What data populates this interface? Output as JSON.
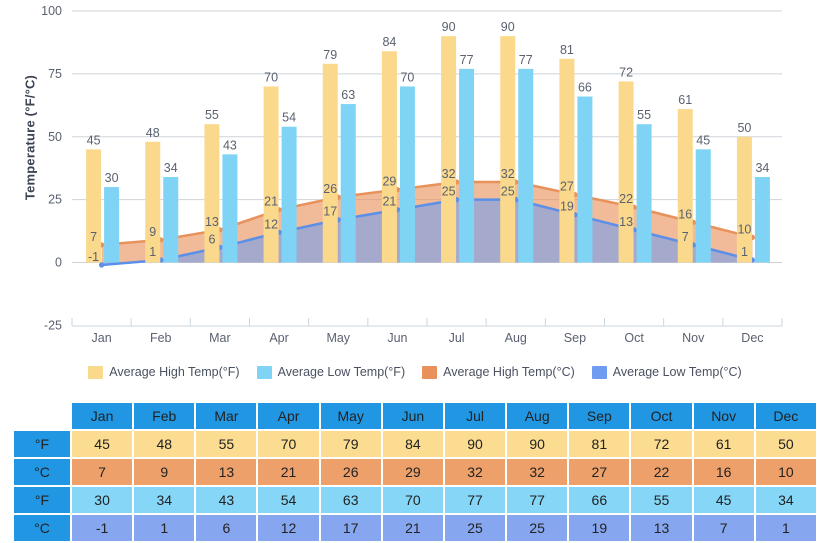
{
  "axis": {
    "y_title": "Temperature (°F/°C)",
    "y_ticks": [
      100,
      75,
      50,
      25,
      0,
      -25
    ],
    "y_min": -25,
    "y_max": 100
  },
  "legend": [
    {
      "label": "Average High Temp(°F)",
      "color": "#fbd98c"
    },
    {
      "label": "Average Low Temp(°F)",
      "color": "#7fd4f5"
    },
    {
      "label": "Average High Temp(°C)",
      "color": "#e8915a"
    },
    {
      "label": "Average Low Temp(°C)",
      "color": "#6f9cf0"
    }
  ],
  "table": {
    "row_labels": [
      "°F",
      "°C",
      "°F",
      "°C"
    ],
    "months": [
      "Jan",
      "Feb",
      "Mar",
      "Apr",
      "May",
      "Jun",
      "Jul",
      "Aug",
      "Sep",
      "Oct",
      "Nov",
      "Dec"
    ],
    "rows": [
      {
        "unit": "°F",
        "kind": "high-f",
        "values": [
          45,
          48,
          55,
          70,
          79,
          84,
          90,
          90,
          81,
          72,
          61,
          50
        ]
      },
      {
        "unit": "°C",
        "kind": "high-c",
        "values": [
          7,
          9,
          13,
          21,
          26,
          29,
          32,
          32,
          27,
          22,
          16,
          10
        ]
      },
      {
        "unit": "°F",
        "kind": "low-f",
        "values": [
          30,
          34,
          43,
          54,
          63,
          70,
          77,
          77,
          66,
          55,
          45,
          34
        ]
      },
      {
        "unit": "°C",
        "kind": "low-c",
        "values": [
          -1,
          1,
          6,
          12,
          17,
          21,
          25,
          25,
          19,
          13,
          7,
          1
        ]
      }
    ]
  },
  "chart_data": {
    "type": "bar",
    "title": "",
    "xlabel": "",
    "ylabel": "Temperature (°F/°C)",
    "ylim": [
      -25,
      100
    ],
    "yticks": [
      -25,
      0,
      25,
      50,
      75,
      100
    ],
    "grid": true,
    "legend_position": "bottom",
    "categories": [
      "Jan",
      "Feb",
      "Mar",
      "Apr",
      "May",
      "Jun",
      "Jul",
      "Aug",
      "Sep",
      "Oct",
      "Nov",
      "Dec"
    ],
    "series": [
      {
        "name": "Average High Temp(°F)",
        "type": "bar",
        "color": "#fbd98c",
        "values": [
          45,
          48,
          55,
          70,
          79,
          84,
          90,
          90,
          81,
          72,
          61,
          50
        ]
      },
      {
        "name": "Average Low Temp(°F)",
        "type": "bar",
        "color": "#7fd4f5",
        "values": [
          30,
          34,
          43,
          54,
          63,
          70,
          77,
          77,
          66,
          55,
          45,
          34
        ]
      },
      {
        "name": "Average High Temp(°C)",
        "type": "area",
        "color": "#e8915a",
        "values": [
          7,
          9,
          13,
          21,
          26,
          29,
          32,
          32,
          27,
          22,
          16,
          10
        ]
      },
      {
        "name": "Average Low Temp(°C)",
        "type": "area",
        "color": "#6f9cf0",
        "values": [
          -1,
          1,
          6,
          12,
          17,
          21,
          25,
          25,
          19,
          13,
          7,
          1
        ]
      }
    ]
  }
}
